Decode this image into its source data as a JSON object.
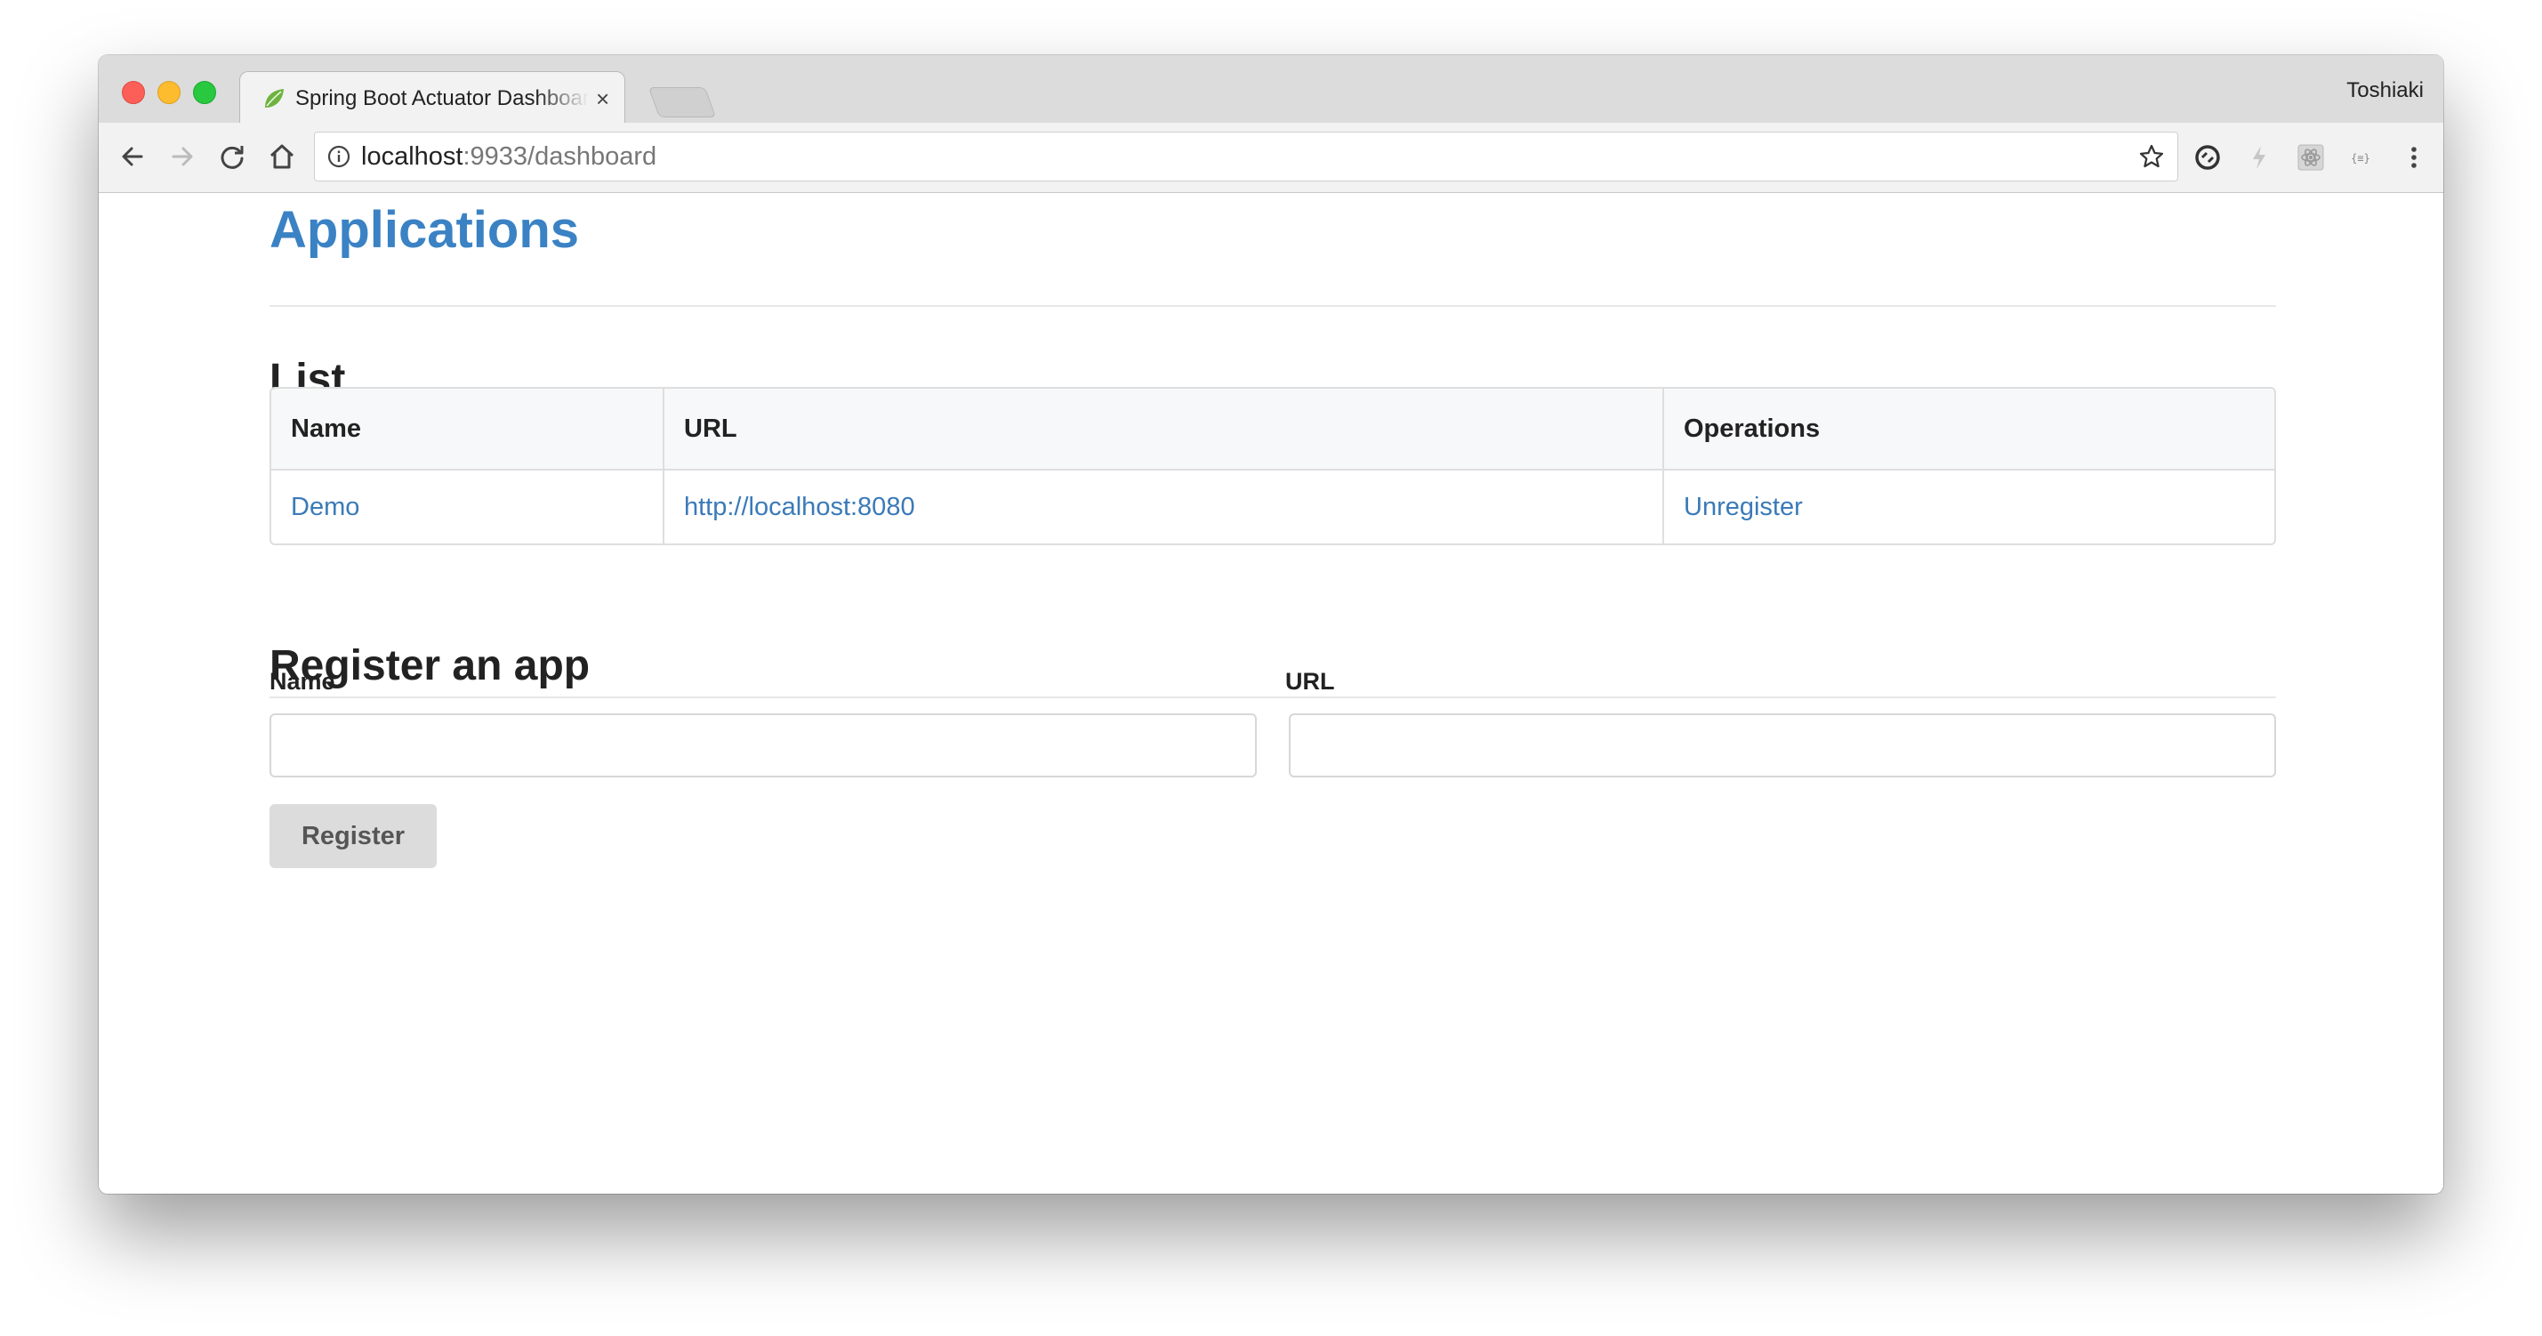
{
  "browser": {
    "tab_title": "Spring Boot Actuator Dashboard",
    "tab_close": "×",
    "profile_name": "Toshiaki",
    "url_host": "localhost",
    "url_rest": ":9933/dashboard"
  },
  "icons": {
    "back": "back-arrow-icon",
    "forward": "forward-arrow-icon",
    "reload": "reload-icon",
    "home": "home-icon",
    "info": "info-icon",
    "star": "bookmark-star-icon",
    "extensions": [
      "sync-extension-icon",
      "lightning-extension-icon",
      "react-devtools-icon",
      "json-viewer-icon",
      "menu-kebab-icon"
    ]
  },
  "page": {
    "title": "Applications",
    "list_heading": "List",
    "table": {
      "headers": [
        "Name",
        "URL",
        "Operations"
      ],
      "rows": [
        {
          "name": "Demo",
          "url": "http://localhost:8080",
          "operation": "Unregister"
        }
      ]
    },
    "register_heading": "Register an app",
    "form": {
      "name_label": "Name",
      "url_label": "URL",
      "name_value": "",
      "url_value": "",
      "submit_label": "Register"
    }
  },
  "colors": {
    "link": "#3a7ab8",
    "title": "#3a82c4",
    "button_bg": "#dcdcdc"
  }
}
